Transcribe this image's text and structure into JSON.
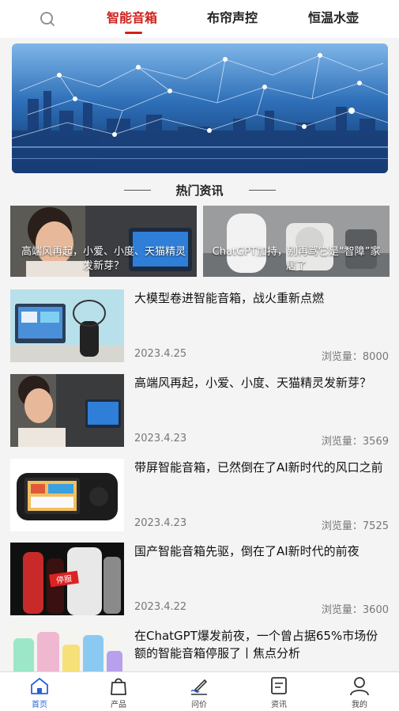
{
  "header": {
    "tabs": [
      {
        "label": "智能音箱",
        "active": true
      },
      {
        "label": "布帘声控",
        "active": false
      },
      {
        "label": "恒温水壶",
        "active": false
      }
    ],
    "search_icon": "search-icon"
  },
  "section": {
    "title": "热门资讯"
  },
  "featured": [
    {
      "caption": "高端风再起，小爱、小度、天猫精灵发新芽？"
    },
    {
      "caption": "ChatGPT加持，别再骂它是“智障”家居了"
    }
  ],
  "articles": [
    {
      "title": "大模型卷进智能音箱，战火重新点燃",
      "date": "2023.4.25",
      "views": "浏览量：8000"
    },
    {
      "title": "高端风再起，小爱、小度、天猫精灵发新芽？",
      "date": "2023.4.23",
      "views": "浏览量：3569"
    },
    {
      "title": "带屏智能音箱，已然倒在了AI新时代的风口之前",
      "date": "2023.4.23",
      "views": "浏览量：7525"
    },
    {
      "title": "国产智能音箱先驱，倒在了AI新时代的前夜",
      "date": "2023.4.22",
      "views": "浏览量：3600"
    },
    {
      "title": "在ChatGPT爆发前夜，一个曾占据65%市场份额的智能音箱停服了丨焦点分析",
      "date": "",
      "views": ""
    }
  ],
  "bottom_nav": [
    {
      "label": "首页",
      "icon": "home-icon",
      "active": true
    },
    {
      "label": "产品",
      "icon": "shopping-bag-icon",
      "active": false
    },
    {
      "label": "问价",
      "icon": "pen-icon",
      "active": false
    },
    {
      "label": "资讯",
      "icon": "news-icon",
      "active": false
    },
    {
      "label": "我的",
      "icon": "user-icon",
      "active": false
    }
  ],
  "colors": {
    "accent": "#d0211c",
    "nav_active": "#2b62d8"
  },
  "thumb_badge": {
    "text": "停服"
  }
}
